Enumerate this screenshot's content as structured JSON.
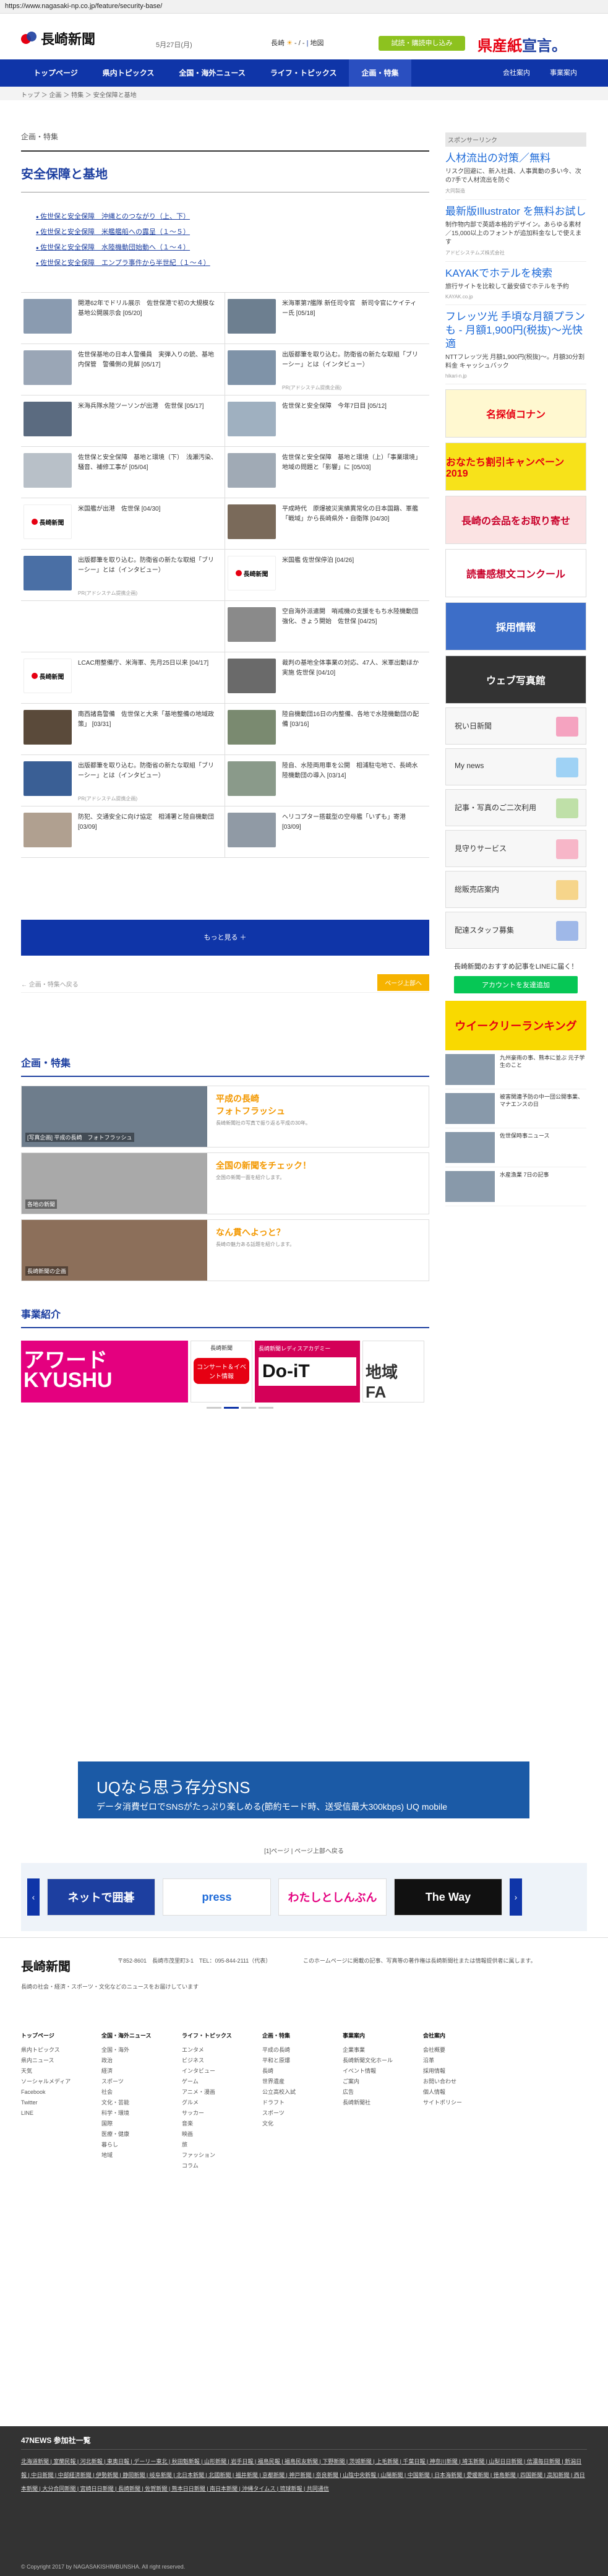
{
  "url": "https://www.nagasaki-np.co.jp/feature/security-base/",
  "header": {
    "logo": "長崎新聞",
    "date": "5月27日(月)",
    "weather_city": "長崎",
    "weather_sun": "☀",
    "weather_text": "- / -",
    "weather_link": "地図",
    "subscribe": "試読・購読申し込み",
    "paper_brand": "県産紙宣言。"
  },
  "nav": {
    "items": [
      "トップページ",
      "県内トピックス",
      "全国・海外ニュース",
      "ライフ・トピックス",
      "企画・特集"
    ],
    "right": [
      "会社案内",
      "事業案内"
    ]
  },
  "breadcrumb": "トップ ＞ 企画 ＞ 特集 ＞ 安全保障と基地",
  "main": {
    "section_label": "企画・特集",
    "title": "安全保障と基地",
    "series": [
      "佐世保と安全保障　沖縄とのつながり（上、下）",
      "佐世保と安全保障　米艦艦船への露呈（１～５）",
      "佐世保と安全保障　水陸機動団始動へ（１～４）",
      "佐世保と安全保障　エンプラ事件から半世紀（１～４）"
    ],
    "cards": [
      {
        "text": "開港62年でドリル展示　佐世保港で初の大規模な基地公開展示会",
        "date": "[05/20]",
        "thumb": "#8a9bb0"
      },
      {
        "text": "米海軍第7艦隊 新任司令官　新司令官にケイティー氏",
        "date": "[05/18]",
        "thumb": "#6d7f90"
      },
      {
        "text": "佐世保基地の日本人警備員　実弾入りの銃、基地内保管　警備側の見解",
        "date": "[05/17]",
        "thumb": "#9aa6b6"
      },
      {
        "text": "出版都筆を取り込む。防衛省の新たな取組「ブリーシー」とは（インタビュー）",
        "date": "",
        "pr": "PR(アドシステム提携企画)",
        "thumb": "#7f93a8"
      },
      {
        "text": "米海兵隊水陸ツーソンが出港　佐世保",
        "date": "[05/17]",
        "thumb": "#5b6b80"
      },
      {
        "text": "佐世保と安全保障　今年7日目",
        "date": "[05/12]",
        "thumb": "#9fb0c0"
      },
      {
        "text": "佐世保と安全保障　基地と環境（下）　浅瀬汚染、騒音、補修工事が",
        "date": "[05/04]",
        "thumb": "#b8c0c8"
      },
      {
        "text": "佐世保と安全保障　基地と環境（上）「事業環境」地域の問題と「影響」に",
        "date": "[05/03]",
        "thumb": "#a0aab5"
      },
      {
        "text": "米国艦が出港　佐世保",
        "date": "[04/30]",
        "thumb": "logo"
      },
      {
        "text": "平成時代　原爆被災実績異常化の日本国籍、軍艦「戦域」から長崎県外・自衛隊",
        "date": "[04/30]",
        "thumb": "#7a6a5a"
      },
      {
        "text": "出版都筆を取り込む。防衛省の新たな取組「ブリーシー」とは（インタビュー）",
        "date": "",
        "pr": "PR(アドシステム提携企画)",
        "thumb": "#4a6fa5"
      },
      {
        "text": "米国艦 佐世保停泊",
        "date": "[04/26]",
        "thumb": "logo"
      },
      {
        "text": "",
        "date": "",
        "thumb": "none"
      },
      {
        "text": "空自海外派遣開　哨戒機の支援をもち水陸機動団強化、きょう開始　佐世保",
        "date": "[04/25]",
        "thumb": "#8a8a8a"
      },
      {
        "text": "LCAC用整備庁、米海軍、先月25日以来",
        "date": "[04/17]",
        "thumb": "logo"
      },
      {
        "text": "裁判の基地全体事業の対応、47人、米軍出動ほか実施 佐世保",
        "date": "[04/10]",
        "thumb": "#6a6a6a"
      },
      {
        "text": "南西諸島警備　佐世保と大来「基地整備の地域政策」",
        "date": "[03/31]",
        "thumb": "#5a4a3a"
      },
      {
        "text": "陸自機動団16日の内整備、各地で水陸機動団の配備",
        "date": "[03/16]",
        "thumb": "#7a8a70"
      },
      {
        "text": "出版都筆を取り込む。防衛省の新たな取組「ブリーシー」とは（インタビュー）",
        "date": "",
        "pr": "PR(アドシステム提携企画)",
        "thumb": "#3a5f95"
      },
      {
        "text": "陸自、水陸両用車を公開　相浦駐屯地で、長崎水陸機動団の導入",
        "date": "[03/14]",
        "thumb": "#8a9a8a"
      },
      {
        "text": "防犯、交通安全に向け協定　相浦署と陸自機動団",
        "date": "[03/09]",
        "thumb": "#b0a090"
      },
      {
        "text": "ヘリコプター搭載型の空母艦「いずも」寄港",
        "date": "[03/09]",
        "thumb": "#909aa5"
      }
    ],
    "more": "もっと見る ＋",
    "back": "← 企画・特集へ戻る",
    "pagetop": "ページ上部へ"
  },
  "features": {
    "heading": "企画・特集",
    "items": [
      {
        "title": "平成の長崎",
        "sub": "フォトフラッシュ",
        "desc": "長崎新聞社の写真で振り返る平成の30年。",
        "cap": "[写真企画] 平成の長崎　フォトフラッシュ",
        "img": "#6e7d8c"
      },
      {
        "title": "全国の新聞をチェック！",
        "sub": "",
        "desc": "全国の新聞一面を紹介します。",
        "cap": "各地の新聞",
        "img": "#a9a9a9"
      },
      {
        "title": "なん貫へよっと？",
        "sub": "",
        "desc": "長崎の魅力ある話題を紹介します。",
        "cap": "長崎新聞の企画",
        "img": "#8c6f5a"
      }
    ]
  },
  "business": {
    "heading": "事業紹介",
    "b1": "アワード KYUSHU",
    "b2_head": "長崎新聞",
    "b2_pill": "コンサート＆イベント情報",
    "b3_head": "長崎新聞レディスアカデミー",
    "b3_big": "Do-iT",
    "b4": "地域 FA"
  },
  "sidebar": {
    "sponsor": "スポンサーリンク",
    "ads": [
      {
        "title": "人材流出の対策／無料",
        "desc": "リスク回避に、新入社員、人事異動の多い今、次の7手で人材流出を防ぐ",
        "src": "大同製造"
      },
      {
        "title": "最新版Illustrator を無料お試し",
        "desc": "制作物内部で英語本格的デザイン。あらゆる素材／15,000以上のフォントが追加料金なしで使えます",
        "src": "アドビシステムズ株式会社"
      },
      {
        "title": "KAYAKでホテルを検索",
        "desc": "旅行サイトを比較して最安値でホテルを予約",
        "src": "KAYAK.co.jp"
      },
      {
        "title": "フレッツ光 手頃な月額プランも - 月額1,900円(税抜)～光快適",
        "desc": "NTTフレッツ光 月額1,900円(税抜)～。月額30分割料金 キャッシュバック",
        "src": "hikari-n.jp"
      }
    ],
    "banners": [
      "名探偵コナン",
      "おなたち割引キャンペーン2019",
      "長崎の会品をお取り寄せ",
      "読書感想文コンクール",
      "採用情報",
      "ウェブ写真館"
    ],
    "links": [
      "祝い日新聞",
      "My news",
      "記事・写真のご二次利用",
      "見守りサービス",
      "総販売店案内",
      "配達スタッフ募集"
    ],
    "line": "長崎新聞のおすすめ記事をLINEに届く！",
    "line_btn": "アカウントを友達追加",
    "ranking": "ウイークリーランキング",
    "news": [
      "九州豪雨の事、熊本に並ぶ 元子学生のこと",
      "被害関連予防の中一団公開事業、マナエンスの日",
      "佐世保時事ニュース",
      "水産漁業 7日の記事"
    ]
  },
  "footer_banner": {
    "t1": "UQなら思う存分SNS",
    "t2": "データ消費ゼロでSNSがたっぷり楽しめる(節約モード時、送受信最大300kbps) UQ mobile"
  },
  "page_links": "[1]ページ | ページ上部へ戻る",
  "carousel": [
    "ネットで囲碁",
    "press",
    "わたしとしんぶん",
    "The Way"
  ],
  "footer": {
    "logo": "長崎新聞",
    "addr": "〒852-8601　長崎市茂里町3-1　TEL：095-844-2111（代表）",
    "note": "長崎の社会・経済・スポーツ・文化などのニュースをお届けしています",
    "right": "このホームページに掲載の記事、写真等の著作権は長崎新聞社または情報提供者に属します。",
    "cols": [
      {
        "h": "トップページ",
        "items": [
          "県内トピックス",
          "県内ニュース",
          "天気",
          "ソーシャルメディア",
          "Facebook",
          "Twitter",
          "LINE"
        ]
      },
      {
        "h": "全国・海外ニュース",
        "items": [
          "全国・海外",
          "政治",
          "経済",
          "スポーツ",
          "社会",
          "文化・芸能",
          "科学・環境",
          "国際",
          "医療・健康",
          "暮らし",
          "地域"
        ]
      },
      {
        "h": "ライフ・トピックス",
        "items": [
          "エンタメ",
          "ビジネス",
          "インタビュー",
          "ゲーム",
          "アニメ・漫画",
          "グルメ",
          "サッカー",
          "音楽",
          "映画",
          "旅",
          "ファッション",
          "コラム"
        ]
      },
      {
        "h": "企画・特集",
        "items": [
          "平成の長崎",
          "平和と原爆",
          "長崎",
          "世界遺産",
          "公立高校入試",
          "ドラフト",
          "スポーツ",
          "文化"
        ]
      },
      {
        "h": "事業案内",
        "items": [
          "企業事業",
          "長崎新聞文化ホール",
          "イベント情報",
          "ご案内",
          "広告",
          "長崎新聞社"
        ]
      },
      {
        "h": "会社案内",
        "items": [
          "会社概要",
          "沿革",
          "採用情報",
          "お問い合わせ",
          "個人情報",
          "サイトポリシー"
        ]
      }
    ]
  },
  "net47": {
    "heading": "47NEWS 参加社一覧",
    "list": "北海道新聞 | 室蘭民報 | 河北新報 | 東奥日報 | デーリー東北 | 秋田魁新報 | 山形新聞 | 岩手日報 | 福島民報 | 福島民友新聞 | 下野新聞 | 茨城新聞 | 上毛新聞 | 千葉日報 | 神奈川新聞 | 埼玉新聞 | 山梨日日新聞 | 信濃毎日新聞 | 新潟日報 | 中日新聞 | 中部経済新聞 | 伊勢新聞 | 静岡新聞 | 岐阜新聞 | 北日本新聞 | 北國新聞 | 福井新聞 | 京都新聞 | 神戸新聞 | 奈良新聞 | 山陰中央新報 | 山陽新聞 | 中国新聞 | 日本海新聞 | 愛媛新聞 | 徳島新聞 | 四国新聞 | 高知新聞 | 西日本新聞 | 大分合同新聞 | 宮崎日日新聞 | 長崎新聞 | 佐賀新聞 | 熊本日日新聞 | 南日本新聞 | 沖縄タイムス | 琉球新報 | 共同通信",
    "copy": "© Copyright 2017 by NAGASAKISHIMBUNSHA. All right reserved."
  }
}
